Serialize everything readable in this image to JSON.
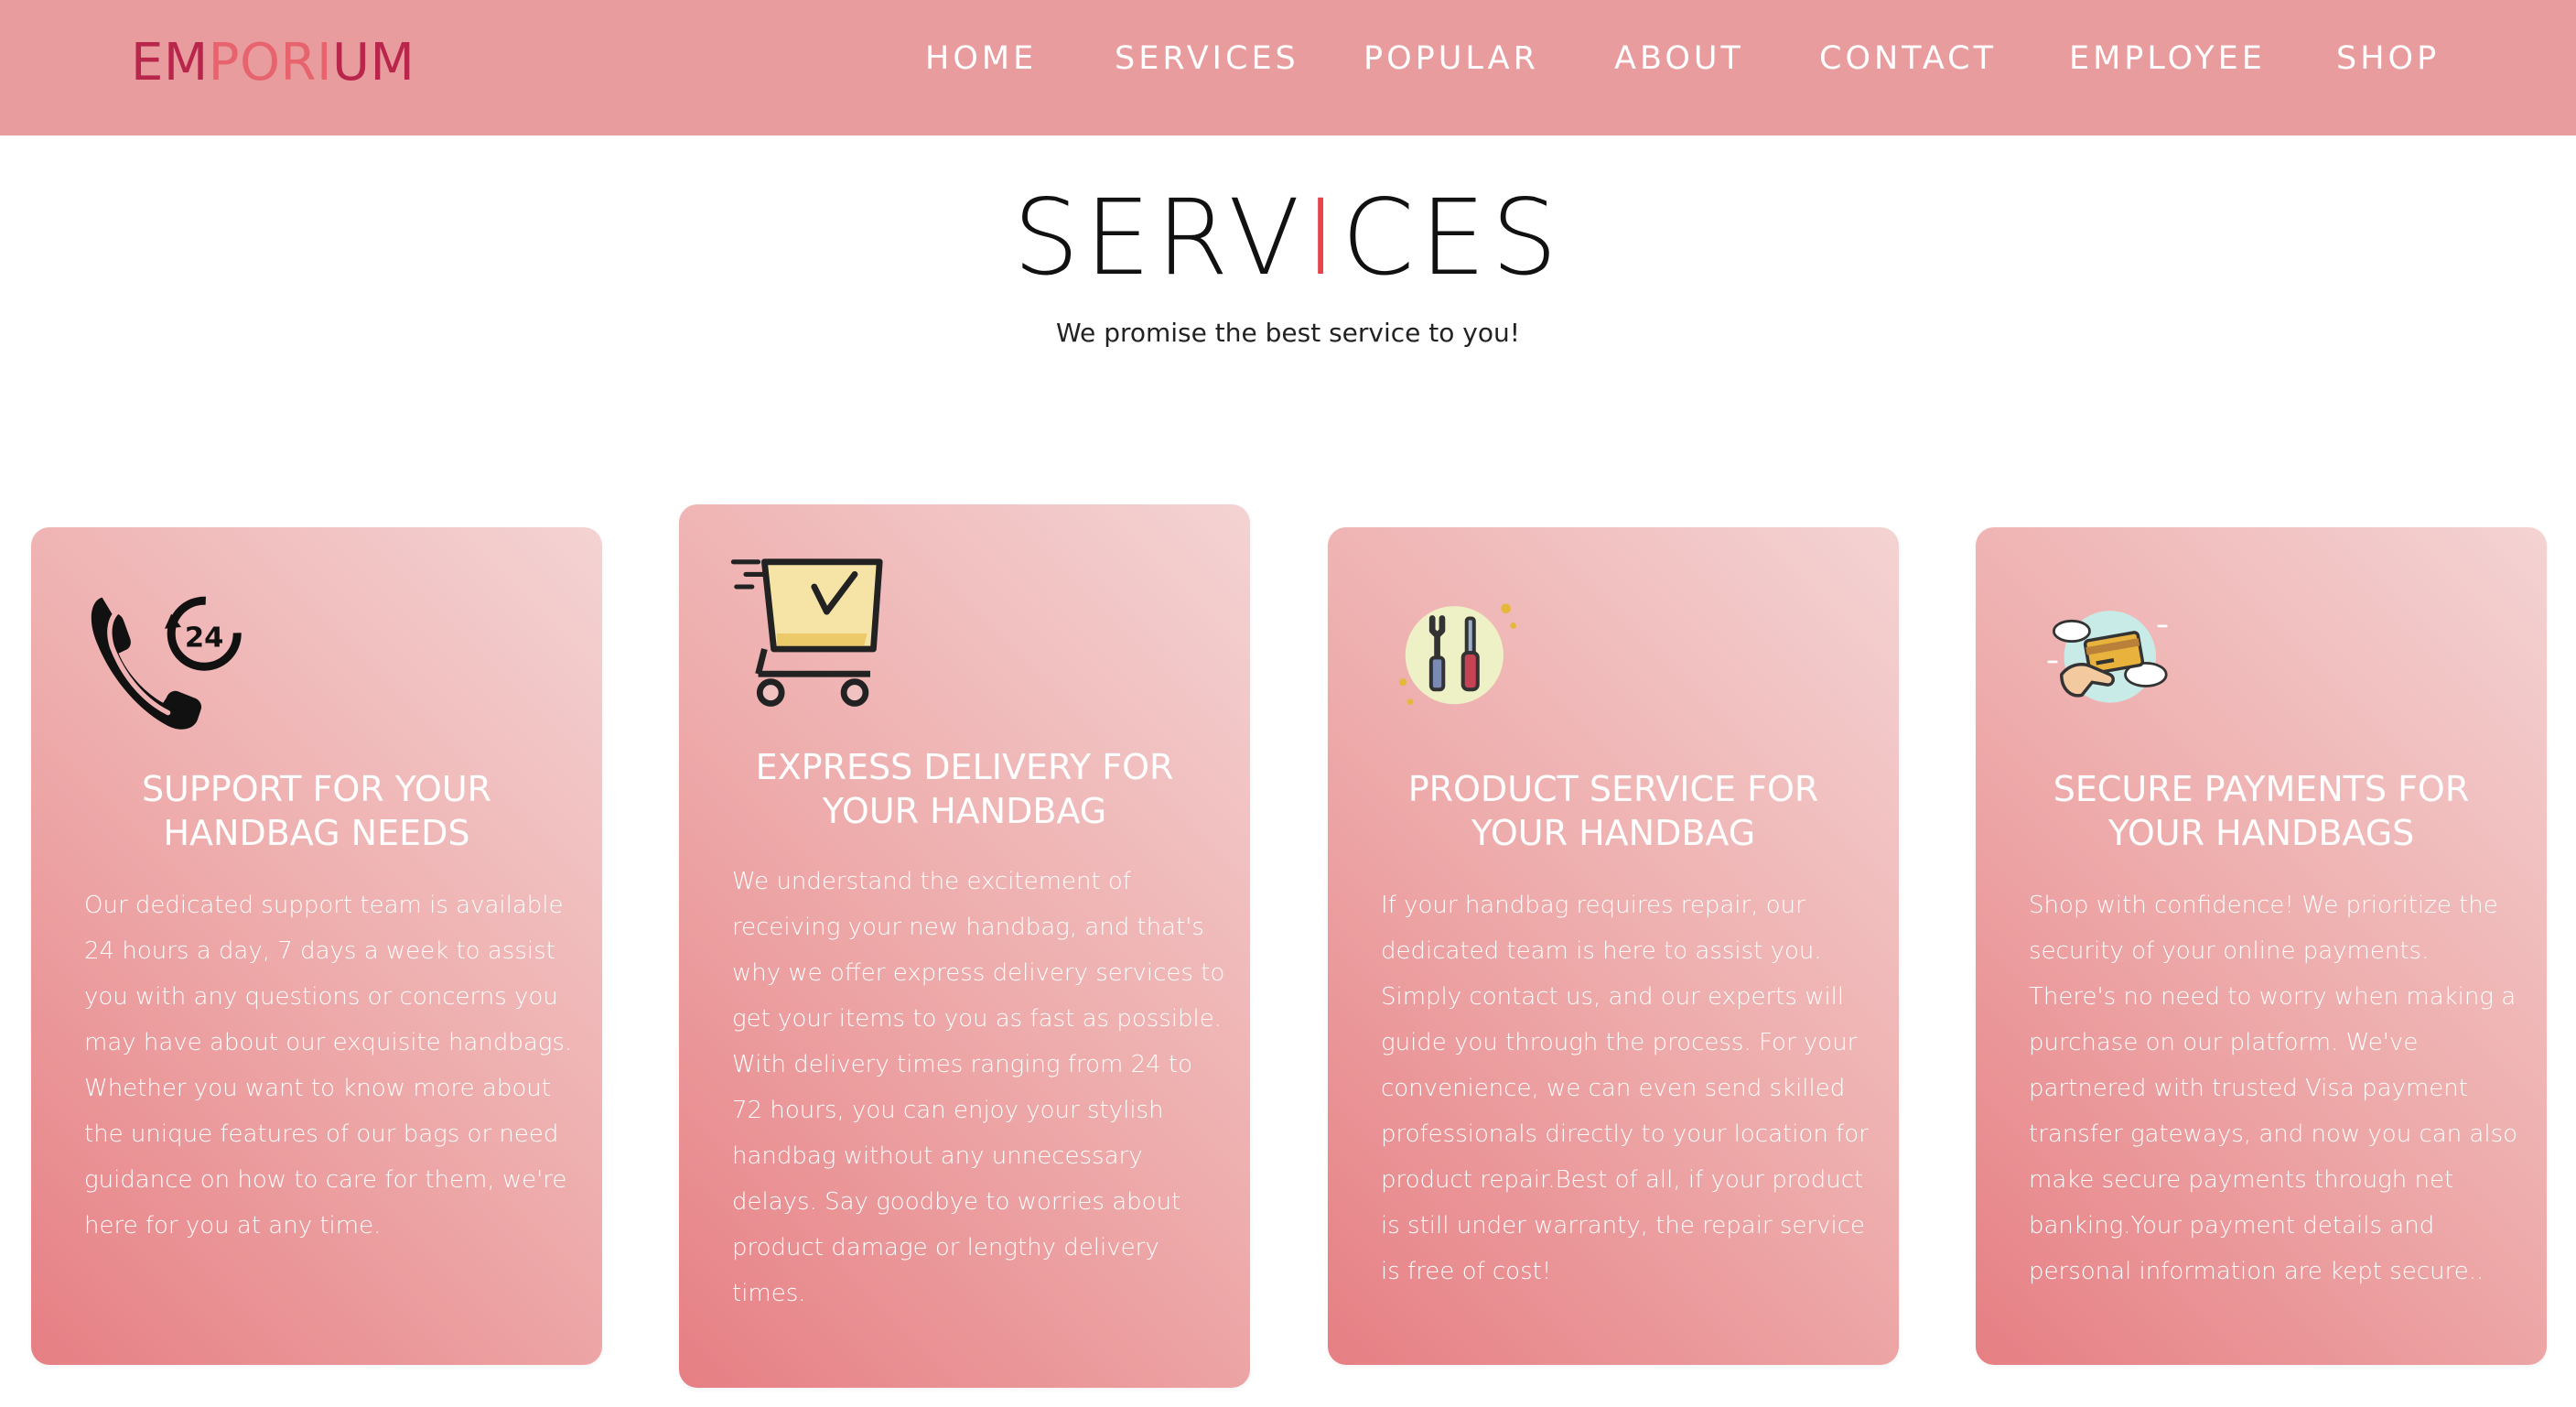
{
  "logo": {
    "part1": "EM",
    "part2": "PORI",
    "part3": "UM"
  },
  "nav": [
    "HOME",
    "SERVICES",
    "POPULAR",
    "ABOUT",
    "CONTACT",
    "EMPLOYEE",
    "SHOP"
  ],
  "section": {
    "title_a": "SERV",
    "title_b": "I",
    "title_c": "CES",
    "subtitle": "We promise the best service to you!"
  },
  "cards": [
    {
      "icon": "phone-24-icon",
      "title_line1": "SUPPORT FOR YOUR",
      "title_line2": "HANDBAG NEEDS",
      "text": "Our dedicated support team is available 24 hours a day, 7 days a week to assist you with any questions or concerns you may have about our exquisite handbags. Whether you want to know more about the unique features of our bags or need guidance on how to care for them, we're here for you at any time."
    },
    {
      "icon": "shopping-cart-icon",
      "title_line1": "EXPRESS DELIVERY FOR",
      "title_line2": "YOUR HANDBAG",
      "text": "We understand the excitement of receiving your new handbag, and that's why we offer express delivery services to get your items to you as fast as possible. With delivery times ranging from 24 to 72 hours, you can enjoy your stylish handbag without any unnecessary delays. Say goodbye to worries about product damage or lengthy delivery times."
    },
    {
      "icon": "repair-tools-icon",
      "title_line1": "PRODUCT SERVICE FOR",
      "title_line2": "YOUR HANDBAG",
      "text": "If your handbag requires repair, our dedicated team is here to assist you. Simply contact us, and our experts will guide you through the process. For your convenience, we can even send skilled professionals directly to your location for product repair.Best of all, if your product is still under warranty, the repair service is free of cost!"
    },
    {
      "icon": "payment-card-icon",
      "title_line1": "SECURE PAYMENTS FOR",
      "title_line2": "YOUR HANDBAGS",
      "text": "Shop with confidence! We prioritize the security of your online payments. There's no need to worry when making a purchase on our platform. We've partnered with trusted Visa payment transfer gateways, and now you can also make secure payments through net banking.Your payment details and personal information are kept secure.."
    }
  ]
}
